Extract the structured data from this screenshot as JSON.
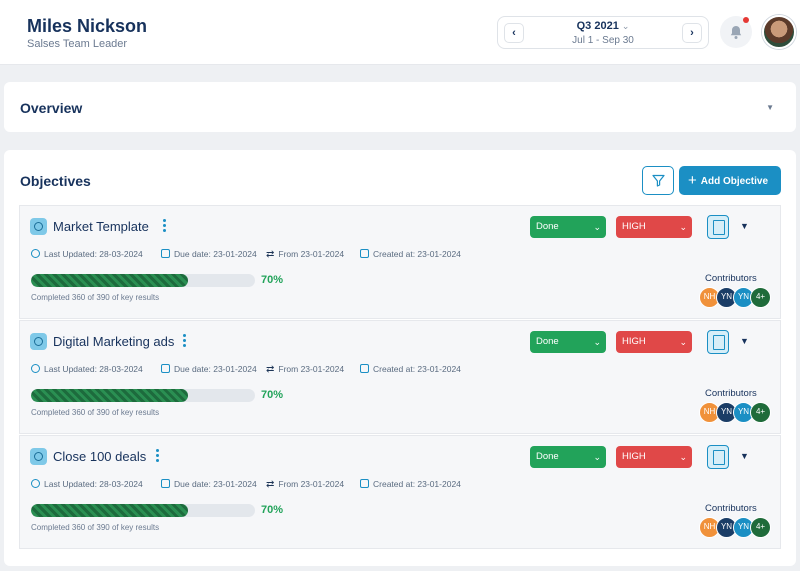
{
  "header": {
    "user_name": "Miles Nickson",
    "user_role": "Salses Team Leader",
    "period": {
      "quarter": "Q3 2021",
      "range": "Jul 1 - Sep 30"
    },
    "has_notification": true
  },
  "overview": {
    "title": "Overview"
  },
  "objectives": {
    "title": "Objectives",
    "add_label": "Add Objective",
    "contributors_label": "Contributors",
    "items": [
      {
        "title": "Market Template",
        "last_updated": "Last Updated: 28-03-2024",
        "due_date": "Due date: 23-01-2024",
        "from": "From 23-01-2024",
        "created": "Created at: 23-01-2024",
        "progress_pct": 70,
        "progress_label": "70%",
        "kr_text": "Completed 360 of 390 of key results",
        "status": "Done",
        "priority": "HIGH",
        "contributors": [
          {
            "initials": "NH",
            "color": "#f0913a"
          },
          {
            "initials": "YN",
            "color": "#1b3d66"
          },
          {
            "initials": "YN",
            "color": "#1b8fc4"
          },
          {
            "initials": "4+",
            "color": "#1f6b3a"
          }
        ]
      },
      {
        "title": "Digital Marketing ads",
        "last_updated": "Last Updated: 28-03-2024",
        "due_date": "Due date: 23-01-2024",
        "from": "From 23-01-2024",
        "created": "Created at: 23-01-2024",
        "progress_pct": 70,
        "progress_label": "70%",
        "kr_text": "Completed 360 of 390 of key results",
        "status": "Done",
        "priority": "HIGH",
        "contributors": [
          {
            "initials": "NH",
            "color": "#f0913a"
          },
          {
            "initials": "YN",
            "color": "#1b3d66"
          },
          {
            "initials": "YN",
            "color": "#1b8fc4"
          },
          {
            "initials": "4+",
            "color": "#1f6b3a"
          }
        ]
      },
      {
        "title": "Close 100 deals",
        "last_updated": "Last Updated: 28-03-2024",
        "due_date": "Due date: 23-01-2024",
        "from": "From 23-01-2024",
        "created": "Created at: 23-01-2024",
        "progress_pct": 70,
        "progress_label": "70%",
        "kr_text": "Completed 360 of 390 of key results",
        "status": "Done",
        "priority": "HIGH",
        "contributors": [
          {
            "initials": "NH",
            "color": "#f0913a"
          },
          {
            "initials": "YN",
            "color": "#1b3d66"
          },
          {
            "initials": "YN",
            "color": "#1b8fc4"
          },
          {
            "initials": "4+",
            "color": "#1f6b3a"
          }
        ]
      }
    ]
  },
  "colors": {
    "accent": "#1b8fc4",
    "status_done": "#22a35a",
    "priority_high": "#e04848",
    "progress": "#22a35a"
  }
}
